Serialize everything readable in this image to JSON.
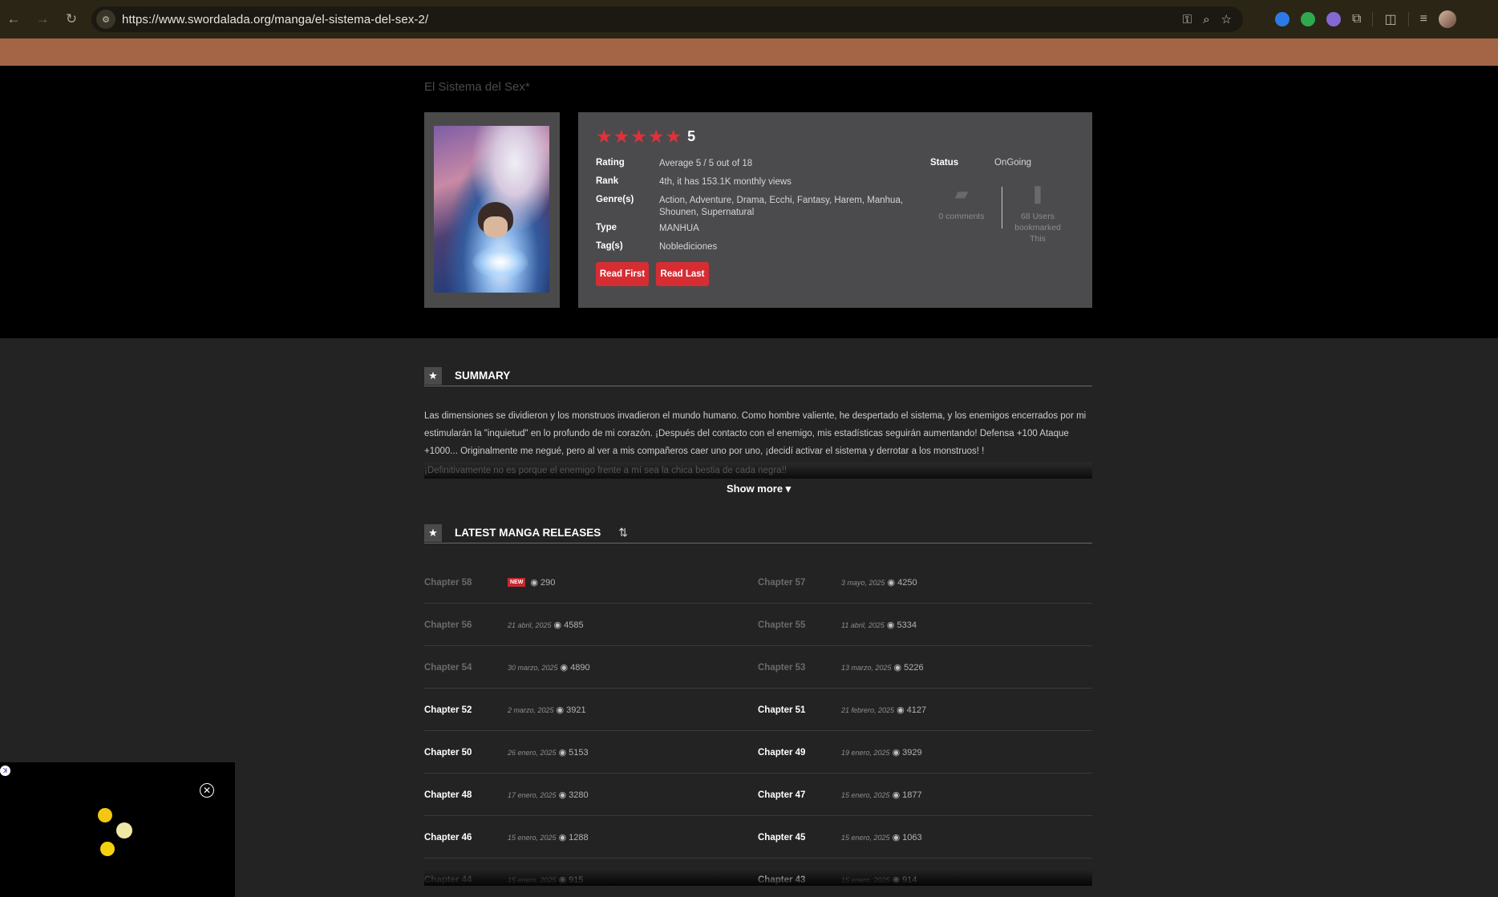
{
  "browser": {
    "url": "https://www.swordalada.org/manga/el-sistema-del-sex-2/"
  },
  "page": {
    "breadcrumb": "El Sistema del Sex*"
  },
  "manga": {
    "score": "5",
    "rating_label": "Rating",
    "rating_value": "Average 5 / 5 out of 18",
    "rank_label": "Rank",
    "rank_value": "4th, it has 153.1K monthly views",
    "genres_label": "Genre(s)",
    "genres_value": "Action,  Adventure,  Drama,  Ecchi,  Fantasy,  Harem,  Manhua,  Shounen,  Supernatural",
    "type_label": "Type",
    "type_value": "MANHUA",
    "tags_label": "Tag(s)",
    "tags_value": "Noblediciones",
    "read_first": "Read First",
    "read_last": "Read Last",
    "status_label": "Status",
    "status_value": "OnGoing",
    "comments": "0 comments",
    "bookmarks": "68 Users bookmarked This"
  },
  "summary": {
    "heading": "SUMMARY",
    "text": "Las dimensiones se dividieron y los monstruos invadieron el mundo humano. Como hombre valiente, he despertado el sistema, y los enemigos encerrados por mi estimularán la \"inquietud\" en lo profundo de mi corazón. ¡Después del contacto con el enemigo, mis estadísticas seguirán aumentando! Defensa +100 Ataque +1000... Originalmente me negué, pero al ver a mis compañeros caer uno por uno, ¡decidí activar el sistema y derrotar a los monstruos! !",
    "fade_text": "¡Definitivamente no es porque el enemigo frente a mí sea la chica bestia de cada negra!!",
    "show_more": "Show more ▾"
  },
  "releases": {
    "heading": "LATEST MANGA RELEASES",
    "new_badge": "NEW",
    "rows": [
      {
        "left": {
          "name": "Chapter 58",
          "date": "",
          "views": "290",
          "dim": true,
          "new": true
        },
        "right": {
          "name": "Chapter 57",
          "date": "3 mayo, 2025",
          "views": "4250",
          "dim": true
        }
      },
      {
        "left": {
          "name": "Chapter 56",
          "date": "21 abril, 2025",
          "views": "4585",
          "dim": true
        },
        "right": {
          "name": "Chapter 55",
          "date": "11 abril, 2025",
          "views": "5334",
          "dim": true
        }
      },
      {
        "left": {
          "name": "Chapter 54",
          "date": "30 marzo, 2025",
          "views": "4890",
          "dim": true
        },
        "right": {
          "name": "Chapter 53",
          "date": "13 marzo, 2025",
          "views": "5226",
          "dim": true
        }
      },
      {
        "left": {
          "name": "Chapter 52",
          "date": "2 marzo, 2025",
          "views": "3921",
          "dim": false
        },
        "right": {
          "name": "Chapter 51",
          "date": "21 febrero, 2025",
          "views": "4127",
          "dim": false
        }
      },
      {
        "left": {
          "name": "Chapter 50",
          "date": "26 enero, 2025",
          "views": "5153",
          "dim": false
        },
        "right": {
          "name": "Chapter 49",
          "date": "19 enero, 2025",
          "views": "3929",
          "dim": false
        }
      },
      {
        "left": {
          "name": "Chapter 48",
          "date": "17 enero, 2025",
          "views": "3280",
          "dim": false
        },
        "right": {
          "name": "Chapter 47",
          "date": "15 enero, 2025",
          "views": "1877",
          "dim": false
        }
      },
      {
        "left": {
          "name": "Chapter 46",
          "date": "15 enero, 2025",
          "views": "1288",
          "dim": false
        },
        "right": {
          "name": "Chapter 45",
          "date": "15 enero, 2025",
          "views": "1063",
          "dim": false
        }
      },
      {
        "left": {
          "name": "Chapter 44",
          "date": "15 enero, 2025",
          "views": "915",
          "dim": true
        },
        "right": {
          "name": "Chapter 43",
          "date": "15 enero, 2025",
          "views": "914",
          "dim": false
        }
      }
    ]
  },
  "float_panel": {
    "close_glyph": "✕"
  }
}
